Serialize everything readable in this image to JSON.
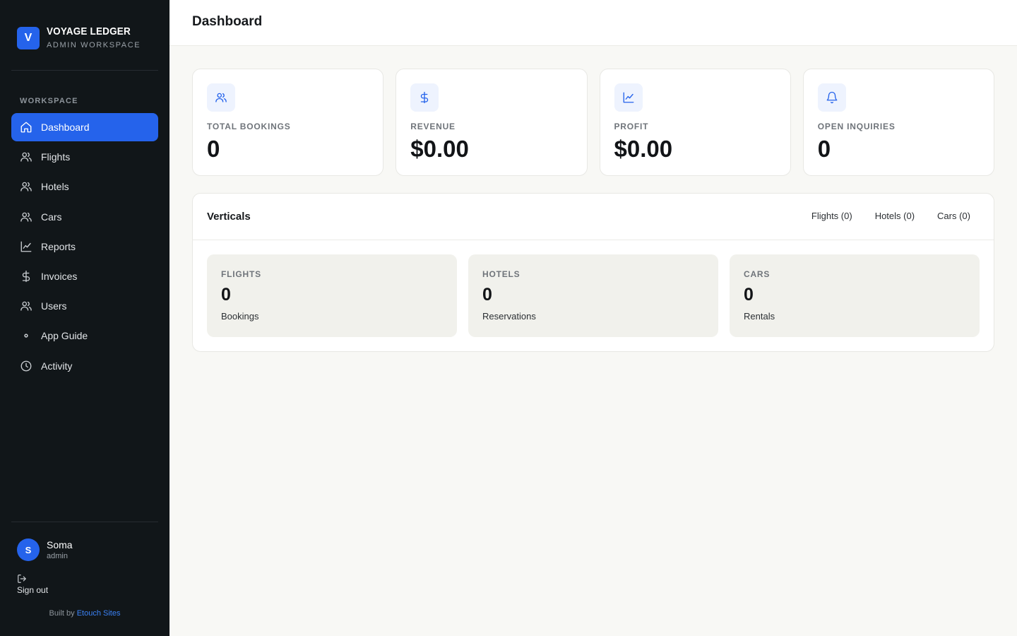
{
  "brand": {
    "logo_letter": "V",
    "name": "VOYAGE LEDGER",
    "subtitle": "ADMIN WORKSPACE",
    "accent": "#2563eb"
  },
  "sidebar": {
    "section_label": "WORKSPACE",
    "items": [
      {
        "label": "Dashboard",
        "icon": "home-icon",
        "active": true
      },
      {
        "label": "Flights",
        "icon": "users-icon"
      },
      {
        "label": "Hotels",
        "icon": "users-icon"
      },
      {
        "label": "Cars",
        "icon": "users-icon"
      },
      {
        "label": "Reports",
        "icon": "chart-line-icon"
      },
      {
        "label": "Invoices",
        "icon": "dollar-icon"
      },
      {
        "label": "Users",
        "icon": "users-icon"
      },
      {
        "label": "App Guide",
        "icon": "dot-icon"
      },
      {
        "label": "Activity",
        "icon": "clock-icon"
      }
    ],
    "user": {
      "initial": "S",
      "name": "Soma",
      "role": "admin"
    },
    "signout_label": "Sign out",
    "built_by_prefix": "Built by",
    "built_by_link": "Etouch Sites"
  },
  "header": {
    "title": "Dashboard"
  },
  "stats": [
    {
      "label": "TOTAL BOOKINGS",
      "value": "0",
      "icon": "users-icon"
    },
    {
      "label": "REVENUE",
      "value": "$0.00",
      "icon": "dollar-icon"
    },
    {
      "label": "PROFIT",
      "value": "$0.00",
      "icon": "chart-line-icon"
    },
    {
      "label": "OPEN INQUIRIES",
      "value": "0",
      "icon": "bell-icon"
    }
  ],
  "verticals": {
    "title": "Verticals",
    "tabs": [
      "Flights (0)",
      "Hotels (0)",
      "Cars (0)"
    ],
    "cards": [
      {
        "label": "FLIGHTS",
        "value": "0",
        "sub": "Bookings"
      },
      {
        "label": "HOTELS",
        "value": "0",
        "sub": "Reservations"
      },
      {
        "label": "CARS",
        "value": "0",
        "sub": "Rentals"
      }
    ]
  }
}
